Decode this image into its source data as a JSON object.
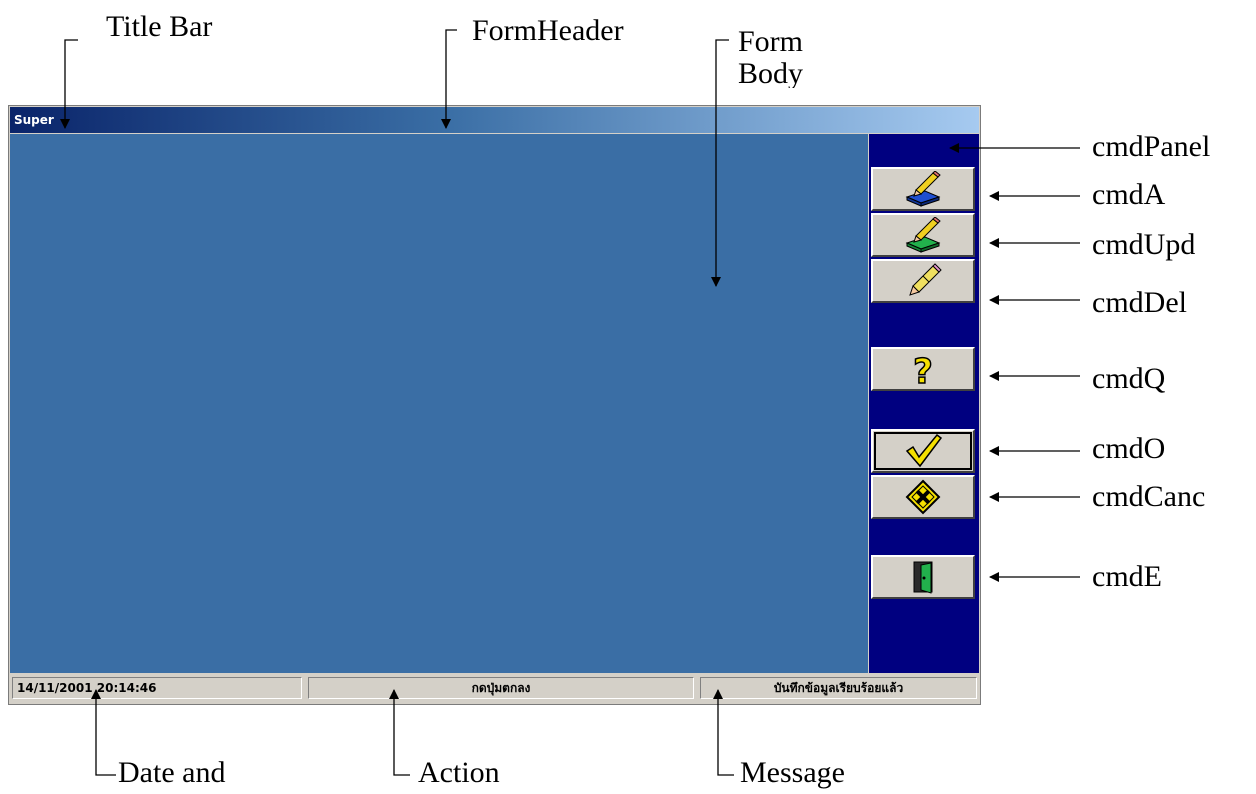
{
  "labels": {
    "title_bar": "Title Bar",
    "form_header": "FormHeader",
    "form_body": "Form Body",
    "cmd_panel": "cmdPanel",
    "cmd_a": "cmdA",
    "cmd_upd": "cmdUpd",
    "cmd_del": "cmdDel",
    "cmd_q": "cmdQ",
    "cmd_o": "cmdO",
    "cmd_canc": "cmdCanc",
    "cmd_e": "cmdE",
    "date_and": "Date and",
    "action": "Action",
    "message": "Message"
  },
  "window": {
    "title": "Super",
    "status": {
      "datetime": "14/11/2001 20:14:46",
      "action": "กดปุ่มตกลง",
      "message": "บันทึกข้อมูลเรียบร้อยแล้ว"
    }
  },
  "colors": {
    "form_body": "#3a6ea5",
    "cmd_panel": "#000080",
    "button_face": "#d4d0c8"
  },
  "icons": {
    "cmd_a": "add-record-pencil-icon",
    "cmd_upd": "update-record-pencil-icon",
    "cmd_del": "eraser-pencil-icon",
    "cmd_q": "question-mark-icon",
    "cmd_o": "check-mark-icon",
    "cmd_canc": "cancel-sign-icon",
    "cmd_e": "exit-door-icon"
  }
}
